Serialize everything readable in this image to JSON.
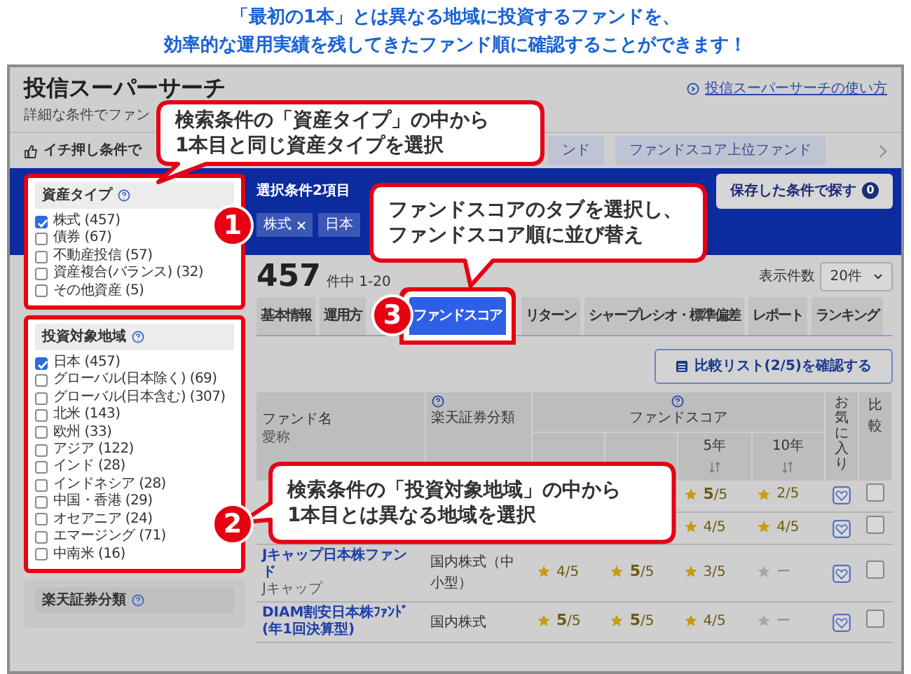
{
  "headline": {
    "lines": [
      "「最初の1本」とは異なる地域に投資するファンドを、",
      "効率的な運用実績を残してきたファンド順に確認することができます！"
    ]
  },
  "page": {
    "title": "投信スーパーサーチ",
    "help_link": "投信スーパーサーチの使い方",
    "subtitle": "詳細な条件でファン"
  },
  "recommend": {
    "label": "イチ押し条件で",
    "chips": [
      "ンド",
      "ファンドスコア上位ファンド"
    ]
  },
  "conditions": {
    "label": "選択条件2項目",
    "saved_button": "保存した条件で探す",
    "saved_count": "0",
    "tags": [
      {
        "text": "株式",
        "removable": true
      },
      {
        "text": "日本",
        "removable": false
      }
    ]
  },
  "sidebar": {
    "sections": [
      {
        "title": "資産タイプ",
        "highlighted": true,
        "items": [
          {
            "label": "株式 (457)",
            "checked": true
          },
          {
            "label": "債券 (67)",
            "checked": false
          },
          {
            "label": "不動産投信 (57)",
            "checked": false
          },
          {
            "label": "資産複合(バランス) (32)",
            "checked": false
          },
          {
            "label": "その他資産 (5)",
            "checked": false
          }
        ]
      },
      {
        "title": "投資対象地域",
        "highlighted": true,
        "items": [
          {
            "label": "日本 (457)",
            "checked": true
          },
          {
            "label": "グローバル(日本除く) (69)",
            "checked": false
          },
          {
            "label": "グローバル(日本含む) (307)",
            "checked": false
          },
          {
            "label": "北米 (143)",
            "checked": false
          },
          {
            "label": "欧州 (33)",
            "checked": false
          },
          {
            "label": "アジア (122)",
            "checked": false
          },
          {
            "label": "インド (28)",
            "checked": false
          },
          {
            "label": "インドネシア (28)",
            "checked": false
          },
          {
            "label": "中国・香港 (29)",
            "checked": false
          },
          {
            "label": "オセアニア (24)",
            "checked": false
          },
          {
            "label": "エマージング (71)",
            "checked": false
          },
          {
            "label": "中南米 (16)",
            "checked": false
          }
        ]
      },
      {
        "title": "楽天証券分類",
        "highlighted": false
      }
    ]
  },
  "results": {
    "total": "457",
    "range": "件中 1-20",
    "per_page_label": "表示件数",
    "per_page": "20件"
  },
  "tabs": [
    {
      "label": "基本情報",
      "selected": false
    },
    {
      "label": "運用方",
      "selected": false
    },
    {
      "label": "ファンドスコア",
      "selected": true
    },
    {
      "label": "リターン",
      "selected": false
    },
    {
      "label": "シャープレシオ・標準偏差",
      "selected": false
    },
    {
      "label": "レポート",
      "selected": false
    },
    {
      "label": "ランキング",
      "selected": false
    }
  ],
  "compare_button": "比較リスト(2/5)を確認する",
  "table": {
    "columns": {
      "name": "ファンド名",
      "nickname": "愛称",
      "category": "楽天証券分類",
      "score": "ファンドスコア",
      "periods": [
        "5年",
        "10年"
      ],
      "favorite": "お気に入り",
      "compare": "比較"
    },
    "rows": [
      {
        "scores": [
          {
            "value": "**5**/5",
            "rated": true
          },
          {
            "value": "2/5",
            "rated": true
          }
        ],
        "compare_checked": false
      },
      {
        "scores": [
          {
            "value": "4/5",
            "rated": true
          },
          {
            "value": "4/5",
            "rated": true
          }
        ],
        "compare_checked": false
      },
      {
        "name": "Jキャップ日本株ファンド",
        "nickname": "Jキャップ",
        "category": "国内株式（中小型）",
        "scores": [
          {
            "value": "4/5",
            "rated": true
          },
          {
            "value": "**5**/5",
            "rated": true
          },
          {
            "value": "3/5",
            "rated": true
          },
          {
            "value": "ー",
            "rated": false
          }
        ],
        "compare_checked": false
      },
      {
        "name": "DIAM割安日本株ﾌｧﾝﾄﾞ(年1回決算型)",
        "category": "国内株式",
        "scores": [
          {
            "value": "**5**/5",
            "rated": true
          },
          {
            "value": "**5**/5",
            "rated": true
          },
          {
            "value": "4/5",
            "rated": true
          },
          {
            "value": "ー",
            "rated": false
          }
        ],
        "compare_checked": false
      }
    ]
  },
  "callouts": [
    {
      "step": "1",
      "lines": [
        "検索条件の「資産タイプ」の中から",
        "1本目と同じ資産タイプを選択"
      ]
    },
    {
      "step": "3",
      "lines": [
        "ファンドスコアのタブを選択し、",
        "ファンドスコア順に並び替え"
      ]
    },
    {
      "step": "2",
      "lines": [
        "検索条件の「投資対象地域」の中から",
        "1本目とは異なる地域を選択"
      ]
    }
  ]
}
